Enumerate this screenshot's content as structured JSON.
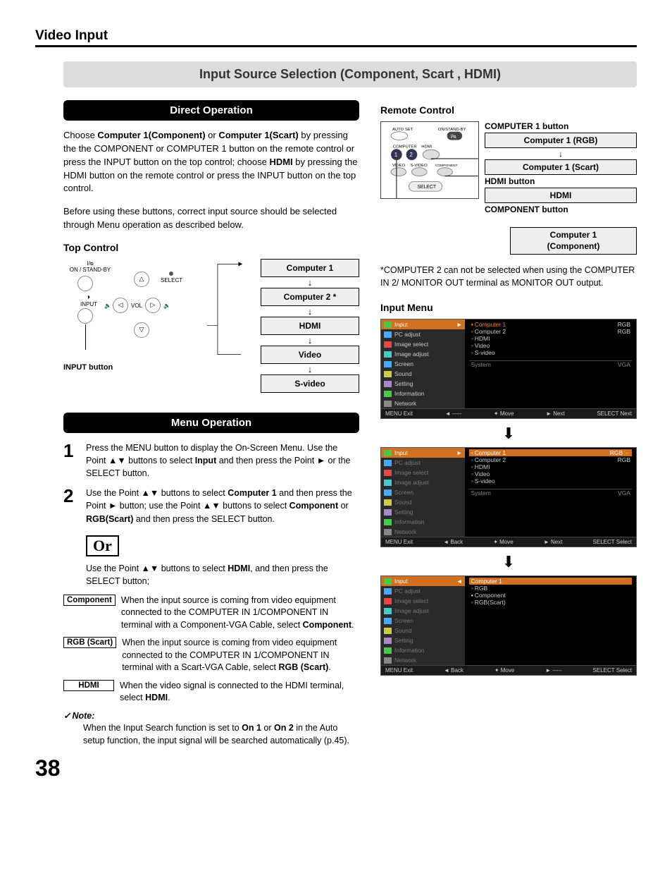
{
  "header": {
    "section": "Video Input"
  },
  "title_bar": "Input Source Selection (Component, Scart , HDMI)",
  "direct_operation": {
    "heading": "Direct Operation",
    "para1_pre": "Choose ",
    "para1_b1": "Computer 1(Component)",
    "para1_mid": " or ",
    "para1_b2": "Computer 1(Scart)",
    "para1_post1": " by pressing the the COMPONENT or COMPUTER 1 button on the remote control or press the INPUT button on the top control; choose ",
    "para1_b3": "HDMI",
    "para1_post2": " by pressing the HDMI button on the remote control or press the INPUT button on the top control.",
    "para2": "Before using these buttons, correct input source should be selected through Menu operation as described below."
  },
  "top_control": {
    "heading": "Top Control",
    "labels": {
      "onstandby": "ON / STAND-BY",
      "select_dot": "SELECT",
      "input": "INPUT",
      "vol": "VOL"
    },
    "input_button": "INPUT button",
    "flow": [
      "Computer 1",
      "Computer 2 *",
      "HDMI",
      "Video",
      "S-video"
    ]
  },
  "menu_operation": {
    "heading": "Menu Operation",
    "step1_pre": "Press the MENU button to display the On-Screen Menu. Use the Point ▲▼ buttons to select ",
    "step1_b": "Input",
    "step1_post": " and then press the Point ► or the SELECT button.",
    "step2_pre": "Use the Point ▲▼ buttons to select ",
    "step2_b1": "Computer 1",
    "step2_mid1": " and then press the Point ► button; use the Point ▲▼ buttons to select ",
    "step2_b2": "Component",
    "step2_mid2": " or ",
    "step2_b3": "RGB(Scart)",
    "step2_post": " and then press the SELECT button.",
    "or": "Or",
    "or_text_pre": "Use the Point ▲▼ buttons to select ",
    "or_text_b": "HDMI",
    "or_text_post": ", and then press the SELECT button;",
    "defs": {
      "component_label": "Component",
      "component_text_pre": "When the input source is coming from video equipment connected to the COMPUTER IN 1/COMPONENT IN terminal with a Component-VGA Cable, select ",
      "component_text_b": "Component",
      "rgb_label": "RGB (Scart)",
      "rgb_text_pre": "When the input source is coming from video equipment connected to the COMPUTER IN 1/COMPONENT IN terminal with a Scart-VGA Cable, select ",
      "rgb_text_b": "RGB (Scart)",
      "hdmi_label": "HDMI",
      "hdmi_text_pre": "When the video signal is connected to the HDMI terminal, select ",
      "hdmi_text_b": "HDMI"
    },
    "note_label": "Note:",
    "note_pre": "When the Input Search function is set to ",
    "note_b1": "On 1",
    "note_mid": " or ",
    "note_b2": "On 2",
    "note_post": " in the Auto setup function, the input signal will be searched automatically (p.45)."
  },
  "remote": {
    "heading": "Remote Control",
    "svg_labels": {
      "autoset": "AUTO SET",
      "onstandby": "ON/STAND-BY",
      "computer": "COMPUTER",
      "hdmi": "HDMI",
      "video": "VIDEO",
      "svideo": "S-VIDEO",
      "component": "COMPONENT",
      "select": "SELECT",
      "n1": "1",
      "n2": "2"
    },
    "labels": {
      "c1button": "COMPUTER 1 button",
      "c1rgb": "Computer 1 (RGB)",
      "c1scart": "Computer 1 (Scart)",
      "hdmibutton": "HDMI button",
      "hdmi": "HDMI",
      "componentbutton": "COMPONENT button",
      "c1component_a": "Computer 1",
      "c1component_b": "(Component)"
    }
  },
  "footnote": {
    "star": "*",
    "text": "COMPUTER 2 can not be selected when using the COMPUTER IN 2/ MONITOR OUT terminal as MONITOR OUT output."
  },
  "input_menu": {
    "heading": "Input Menu",
    "left_items": [
      "Input",
      "PC adjust",
      "Image select",
      "Image adjust",
      "Screen",
      "Sound",
      "Setting",
      "Information",
      "Network"
    ],
    "shot1": {
      "right": [
        {
          "l": "Computer 1",
          "r": "RGB",
          "sel": true
        },
        {
          "l": "Computer 2",
          "r": "RGB"
        },
        {
          "l": "HDMI",
          "r": ""
        },
        {
          "l": "Video",
          "r": ""
        },
        {
          "l": "S-video",
          "r": ""
        }
      ],
      "system": {
        "l": "System",
        "r": "VGA"
      },
      "footer": [
        "MENU Exit",
        "◄ -----",
        "✦ Move",
        "► Next",
        "SELECT Next"
      ]
    },
    "shot2": {
      "right": [
        {
          "l": "Computer 1",
          "r": "RGB",
          "selbar": true
        },
        {
          "l": "Computer 2",
          "r": "RGB"
        },
        {
          "l": "HDMI",
          "r": ""
        },
        {
          "l": "Video",
          "r": ""
        },
        {
          "l": "S-video",
          "r": ""
        }
      ],
      "system": {
        "l": "System",
        "r": "VGA"
      },
      "footer": [
        "MENU Exit",
        "◄ Back",
        "✦ Move",
        "► Next",
        "SELECT Select"
      ]
    },
    "shot3": {
      "header": "Computer 1",
      "right": [
        {
          "l": "RGB"
        },
        {
          "l": "Component",
          "sel": true
        },
        {
          "l": "RGB(Scart)"
        }
      ],
      "footer": [
        "MENU Exit",
        "◄ Back",
        "✦ Move",
        "► -----",
        "SELECT Select"
      ]
    }
  },
  "page_number": "38"
}
